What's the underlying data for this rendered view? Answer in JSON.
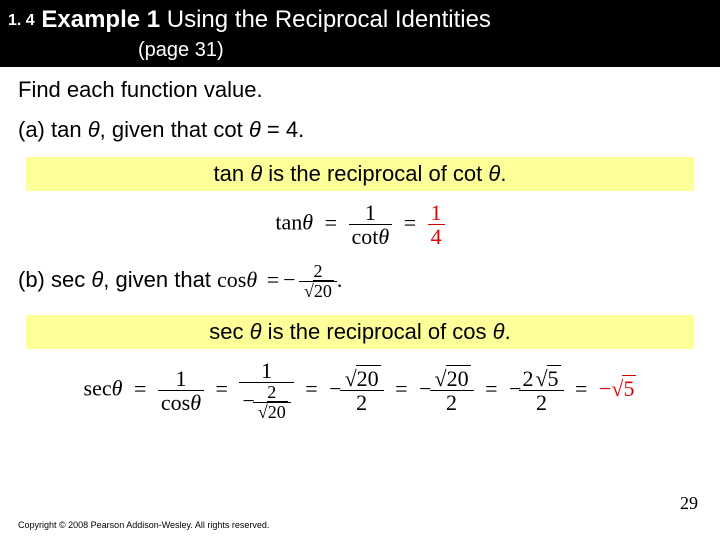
{
  "header": {
    "section": "1. 4",
    "title_prefix": "Example 1",
    "title_rest": " Using the Reciprocal Identities",
    "subtitle": "(page 31)"
  },
  "instruction": "Find each function value.",
  "part_a": {
    "label": "(a)  tan ",
    "theta": "θ",
    "given": ", given that cot ",
    "value": " = 4.",
    "highlight_pre": "tan ",
    "highlight_mid": " is the reciprocal of cot ",
    "highlight_end": ".",
    "eq_lhs": "tan",
    "eq_theta": "θ",
    "eq_eq": "=",
    "frac1_num": "1",
    "frac1_den_pre": "cot",
    "result_num": "1",
    "result_den": "4"
  },
  "part_b": {
    "label": "(b)  sec ",
    "theta": "θ",
    "given": ", given that  ",
    "cos_lhs": "cos",
    "eq": "=",
    "minus": "−",
    "num2": "2",
    "den_sqrt": "20",
    "period": ".",
    "highlight_pre": "sec ",
    "highlight_mid": " is the reciprocal of cos ",
    "highlight_end": ".",
    "sec": "sec",
    "one": "1",
    "cos": "cos",
    "s20": "20",
    "two": "2",
    "twosqrt5": "5",
    "sqrt5": "5"
  },
  "pagenum": "29",
  "copyright": "Copyright © 2008 Pearson Addison-Wesley.  All rights reserved."
}
